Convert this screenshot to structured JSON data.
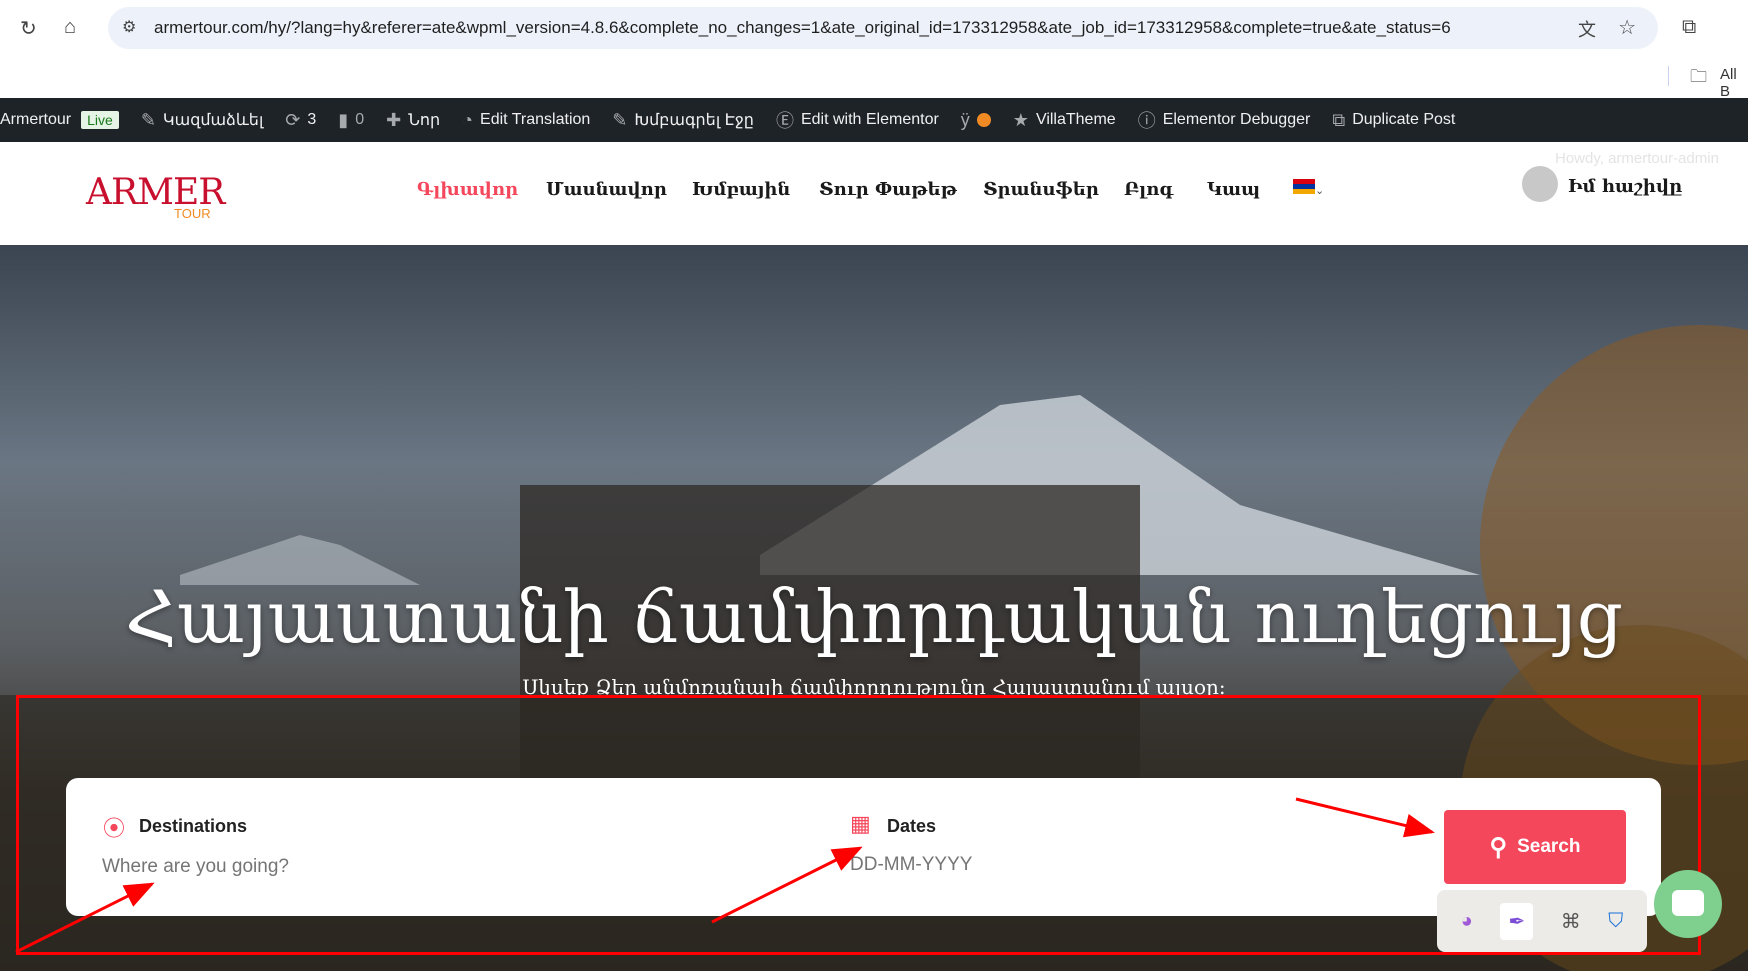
{
  "browser": {
    "url": "armertour.com/hy/?lang=hy&referer=ate&wpml_version=4.8.6&complete_no_changes=1&ate_original_id=173312958&ate_job_id=173312958&complete=true&ate_status=6",
    "bookmarks_label": "All B"
  },
  "adminbar": {
    "site": "Armertour",
    "live": "Live",
    "customize": "Կազմաձևել",
    "updates": "3",
    "comments": "0",
    "new": "Նոր",
    "edit_translation": "Edit Translation",
    "edit_page": "Խմբագրել Էջը",
    "edit_elementor": "Edit with Elementor",
    "villatheme": "VillaTheme",
    "debugger": "Elementor Debugger",
    "duplicate": "Duplicate Post",
    "howdy": "Howdy, armertour-admin"
  },
  "header": {
    "logo_main": "ARMER",
    "logo_sub": "TOUR",
    "nav": [
      "Գլխավոր",
      "Մասնավոր",
      "Խմբային",
      "Տուր Փաթեթ",
      "Տրանսֆեր",
      "Բլոգ",
      "Կապ"
    ],
    "account": "Իմ հաշիվը"
  },
  "hero": {
    "title": "Հայաստանի ճամփորդական ուղեցույց",
    "subtitle": "Սկսեք Ձեր անմոռանալի ճամփորդությունը Հայաստանում այսօր:"
  },
  "search": {
    "destinations_label": "Destinations",
    "destinations_placeholder": "Where are you going?",
    "dates_label": "Dates",
    "dates_placeholder": "DD-MM-YYYY",
    "button": "Search"
  },
  "colors": {
    "accent": "#f5475c",
    "adminbar": "#1d2327",
    "annotation": "#ff0000"
  }
}
